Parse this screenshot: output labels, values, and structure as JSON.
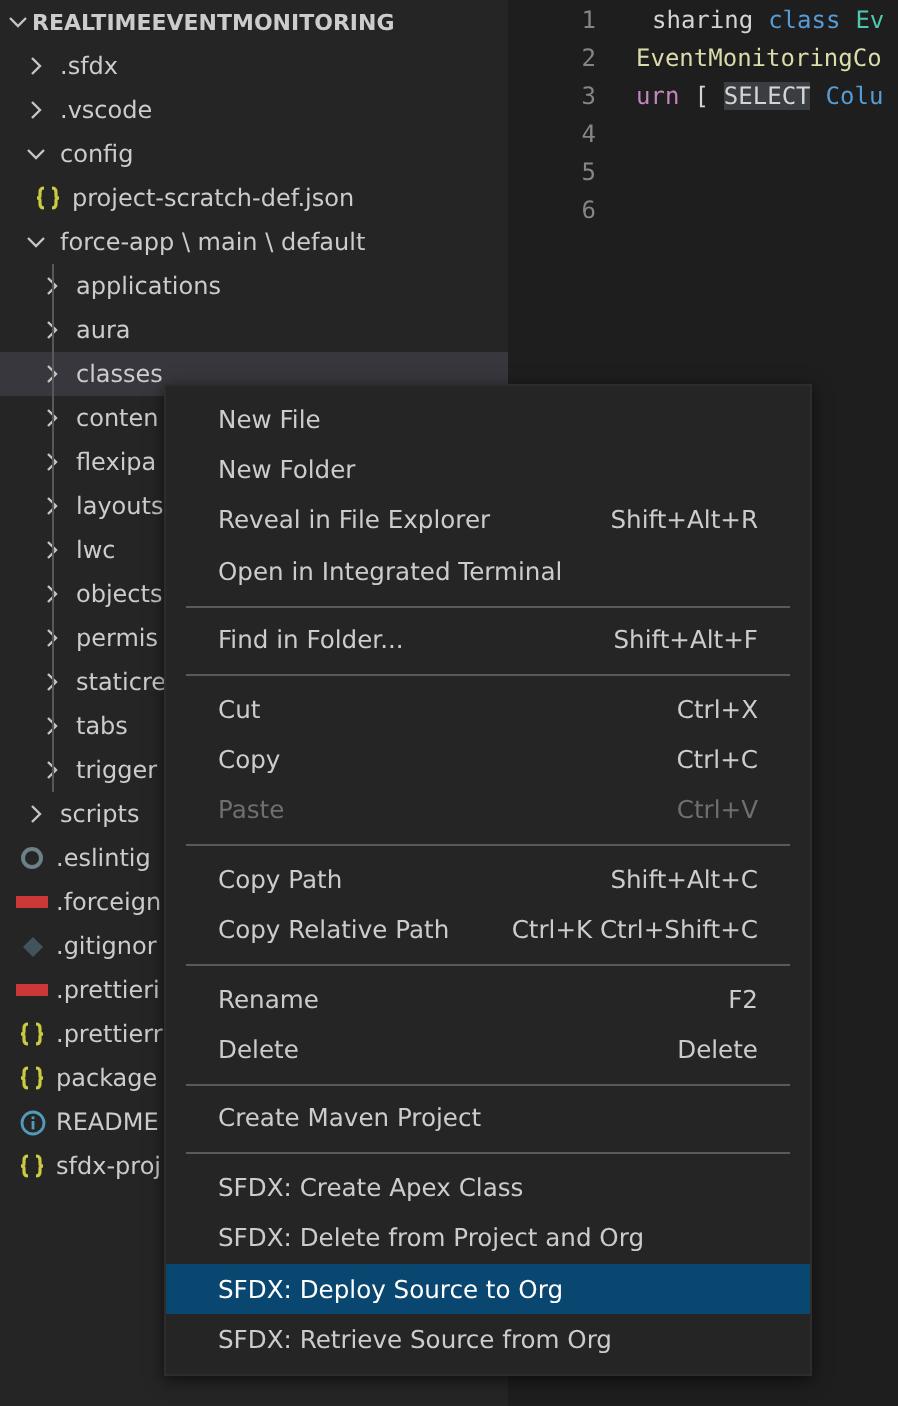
{
  "explorer": {
    "title": "REALTIMEEVENTMONITORING",
    "expanded": true,
    "items": [
      {
        "label": ".sfdx",
        "kind": "folder",
        "expanded": false
      },
      {
        "label": ".vscode",
        "kind": "folder",
        "expanded": false
      },
      {
        "label": "config",
        "kind": "folder",
        "expanded": true,
        "children": [
          {
            "label": "project-scratch-def.json",
            "kind": "json"
          }
        ]
      },
      {
        "label": "force-app \\ main \\ default",
        "kind": "folder",
        "expanded": true,
        "children": [
          {
            "label": "applications",
            "kind": "folder",
            "expanded": false,
            "selected": false
          },
          {
            "label": "aura",
            "kind": "folder",
            "expanded": false,
            "selected": false
          },
          {
            "label": "classes",
            "kind": "folder",
            "expanded": false,
            "selected": true
          },
          {
            "label": "conten",
            "kind": "folder",
            "expanded": false,
            "selected": false
          },
          {
            "label": "flexipa",
            "kind": "folder",
            "expanded": false,
            "selected": false
          },
          {
            "label": "layouts",
            "kind": "folder",
            "expanded": false,
            "selected": false
          },
          {
            "label": "lwc",
            "kind": "folder",
            "expanded": false,
            "selected": false
          },
          {
            "label": "objects",
            "kind": "folder",
            "expanded": false,
            "selected": false
          },
          {
            "label": "permis",
            "kind": "folder",
            "expanded": false,
            "selected": false
          },
          {
            "label": "staticre",
            "kind": "folder",
            "expanded": false,
            "selected": false
          },
          {
            "label": "tabs",
            "kind": "folder",
            "expanded": false,
            "selected": false
          },
          {
            "label": "trigger",
            "kind": "folder",
            "expanded": false,
            "selected": false
          }
        ]
      },
      {
        "label": "scripts",
        "kind": "folder",
        "expanded": false
      },
      {
        "label": ".eslintig",
        "kind": "eslint"
      },
      {
        "label": ".forceign",
        "kind": "npm"
      },
      {
        "label": ".gitignor",
        "kind": "git"
      },
      {
        "label": ".prettieri",
        "kind": "npm"
      },
      {
        "label": ".prettierr",
        "kind": "json"
      },
      {
        "label": "package",
        "kind": "json"
      },
      {
        "label": "README",
        "kind": "info"
      },
      {
        "label": "sfdx-proj",
        "kind": "json"
      }
    ]
  },
  "editor": {
    "lines": [
      {
        "number": "1",
        "tokens": [
          {
            "text": "sharing",
            "kind": "plain"
          },
          {
            "text": "class",
            "kind": "keyword"
          },
          {
            "text": "Ev",
            "kind": "type"
          }
        ]
      },
      {
        "number": "2",
        "tokens": [
          {
            "text": "EventMonitoringCo",
            "kind": "function"
          }
        ]
      },
      {
        "number": "3",
        "tokens": [
          {
            "text": "urn",
            "kind": "control"
          },
          {
            "text": "[",
            "kind": "plain"
          },
          {
            "text": "SELECT",
            "kind": "highlight"
          },
          {
            "text": "Colu",
            "kind": "keyword"
          }
        ]
      },
      {
        "number": "4"
      },
      {
        "number": "5"
      },
      {
        "number": "6"
      }
    ]
  },
  "context_menu": {
    "groups": [
      [
        {
          "label": "New File",
          "disabled": false,
          "selected": false
        },
        {
          "label": "New Folder",
          "disabled": false,
          "selected": false
        },
        {
          "label": "Reveal in File Explorer",
          "shortcut": "Shift+Alt+R",
          "disabled": false,
          "selected": false
        },
        {
          "label": "Open in Integrated Terminal",
          "disabled": false,
          "selected": false
        }
      ],
      [
        {
          "label": "Find in Folder...",
          "shortcut": "Shift+Alt+F",
          "disabled": false,
          "selected": false
        }
      ],
      [
        {
          "label": "Cut",
          "shortcut": "Ctrl+X",
          "disabled": false,
          "selected": false
        },
        {
          "label": "Copy",
          "shortcut": "Ctrl+C",
          "disabled": false,
          "selected": false
        },
        {
          "label": "Paste",
          "shortcut": "Ctrl+V",
          "disabled": true,
          "selected": false
        }
      ],
      [
        {
          "label": "Copy Path",
          "shortcut": "Shift+Alt+C",
          "disabled": false,
          "selected": false
        },
        {
          "label": "Copy Relative Path",
          "shortcut": "Ctrl+K Ctrl+Shift+C",
          "disabled": false,
          "selected": false
        }
      ],
      [
        {
          "label": "Rename",
          "shortcut": "F2",
          "disabled": false,
          "selected": false
        },
        {
          "label": "Delete",
          "shortcut": "Delete",
          "disabled": false,
          "selected": false
        }
      ],
      [
        {
          "label": "Create Maven Project",
          "disabled": false,
          "selected": false
        }
      ],
      [
        {
          "label": "SFDX: Create Apex Class",
          "disabled": false,
          "selected": false
        },
        {
          "label": "SFDX: Delete from Project and Org",
          "disabled": false,
          "selected": false
        },
        {
          "label": "SFDX: Deploy Source to Org",
          "disabled": false,
          "selected": true
        },
        {
          "label": "SFDX: Retrieve Source from Org",
          "disabled": false,
          "selected": false
        }
      ]
    ]
  }
}
